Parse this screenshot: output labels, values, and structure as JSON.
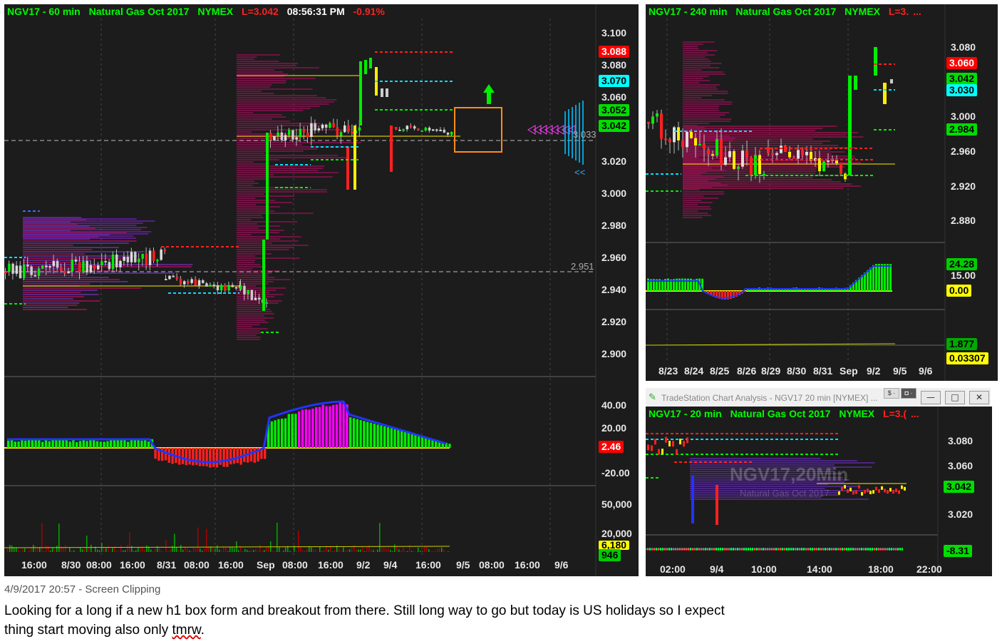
{
  "left_chart": {
    "symbol": "NGV17 - 60 min",
    "name": "Natural Gas Oct 2017",
    "exchange": "NYMEX",
    "last": "L=3.042",
    "time": "08:56:31 PM",
    "change": "-0.91%",
    "price_axis": [
      "3.100",
      "3.080",
      "3.060",
      "3.020",
      "3.000",
      "2.980",
      "2.960",
      "2.940",
      "2.920",
      "2.900"
    ],
    "tags": [
      {
        "text": "3.088",
        "bg": "#ff0000",
        "fg": "#ffffff"
      },
      {
        "text": "3.070",
        "bg": "#00ffff",
        "fg": "#000000"
      },
      {
        "text": "3.052",
        "bg": "#00dd00",
        "fg": "#000000"
      },
      {
        "text": "3.042",
        "bg": "#00dd00",
        "fg": "#000000"
      }
    ],
    "ref_line_1": "3.033",
    "ref_line_2": "2.951",
    "arrow_text": "<<",
    "osc_axis": [
      "40.00",
      "20.00",
      "-20.00"
    ],
    "osc_tag": "2.46",
    "vol_axis": [
      "50,000",
      "20,000"
    ],
    "vol_tag_1": "6,180",
    "vol_tag_2": "946",
    "dates": [
      "16:00",
      "8/30",
      "08:00",
      "16:00",
      "8/31",
      "08:00",
      "16:00",
      "Sep",
      "08:00",
      "16:00",
      "9/2",
      "9/4",
      "16:00",
      "9/5",
      "08:00",
      "16:00",
      "9/6"
    ]
  },
  "right_top_chart": {
    "symbol": "NGV17 - 240 min",
    "name": "Natural Gas Oct 2017",
    "exchange": "NYMEX",
    "last": "L=3.",
    "ellipsis": "...",
    "price_axis": [
      "3.080",
      "3.000",
      "2.960",
      "2.920",
      "2.880"
    ],
    "tags": [
      {
        "text": "3.060",
        "bg": "#ff0000",
        "fg": "#ffffff"
      },
      {
        "text": "3.042",
        "bg": "#00dd00",
        "fg": "#000000"
      },
      {
        "text": "3.030",
        "bg": "#00ffff",
        "fg": "#000000"
      },
      {
        "text": "2.984",
        "bg": "#00dd00",
        "fg": "#000000"
      }
    ],
    "osc_tag_1": "24.28",
    "osc_label": "15.00",
    "osc_tag_2": "0.00",
    "vol_tag_1": "1.877",
    "vol_tag_2": "0.03307",
    "dates": [
      "8/23",
      "8/24",
      "8/25",
      "8/26",
      "8/29",
      "8/30",
      "8/31",
      "Sep",
      "9/2",
      "9/5",
      "9/6"
    ]
  },
  "right_bottom_chart": {
    "window_title": "TradeStation Chart Analysis - NGV17 20 min [NYMEX] ...",
    "symbol": "NGV17 - 20 min",
    "name": "Natural Gas Oct 2017",
    "exchange": "NYMEX",
    "last": "L=3.(",
    "ellipsis": "...",
    "watermark_1": "NGV17,20Min",
    "watermark_2": "Natural Gas Oct 2017",
    "price_axis": [
      "3.080",
      "3.060",
      "3.020"
    ],
    "tag": "3.042",
    "osc_tag": "-8.31",
    "dates": [
      "02:00",
      "9/4",
      "10:00",
      "14:00",
      "18:00",
      "22:00"
    ]
  },
  "clipping": {
    "caption": "4/9/2017 20:57 - Screen Clipping",
    "note_line_1": "Looking for a long if a new h1 box form and breakout from there. Still long way to go but today is US holidays so I expect",
    "note_line_2_a": "thing start moving also only ",
    "note_line_2_b": "tmrw",
    "note_line_2_c": "."
  },
  "colors": {
    "panel_bg": "#1c1c1c",
    "green": "#00ff00",
    "red": "#ff0000",
    "cyan": "#00ffff",
    "magenta": "#ff00ff",
    "yellow": "#ffff00"
  }
}
